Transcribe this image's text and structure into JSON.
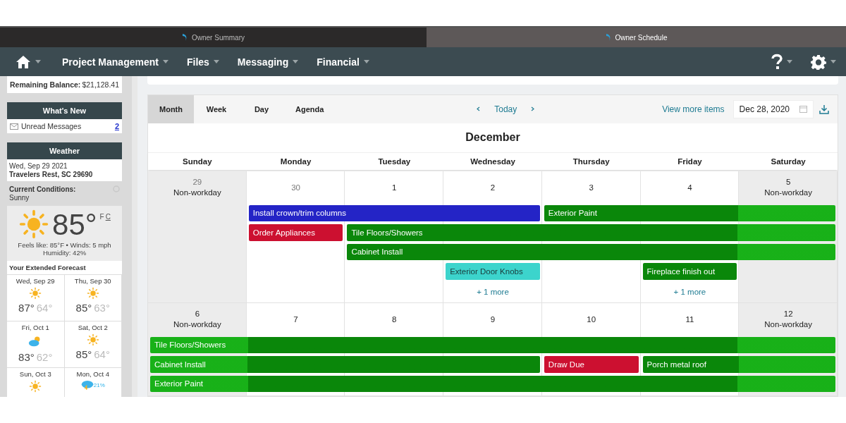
{
  "browser_tabs": [
    {
      "label": "Owner Summary",
      "selected": false
    },
    {
      "label": "Owner Schedule",
      "selected": true
    }
  ],
  "nav": {
    "menus": [
      "Project Management",
      "Files",
      "Messaging",
      "Financial"
    ]
  },
  "sidebar": {
    "balance": {
      "label": "Remaining Balance:",
      "value": "$21,128.41"
    },
    "whats_new": {
      "title": "What's New",
      "items": [
        {
          "label": "Unread Messages",
          "count": "2"
        }
      ]
    },
    "weather": {
      "title": "Weather",
      "date": "Wed, Sep 29 2021",
      "location": "Travelers Rest, SC 29690",
      "conditions_label": "Current Conditions:",
      "conditions": "Sunny",
      "temperature": "85°",
      "units": [
        {
          "label": "F",
          "selected": true
        },
        {
          "label": "C",
          "selected": false
        }
      ],
      "details": [
        "Feels like: 85°F • Winds: 5 mph",
        "Humidity: 42%"
      ],
      "forecast_title": "Your Extended Forecast",
      "forecast": [
        {
          "day": "Wed, Sep 29",
          "kind": "sunny",
          "high": "87°",
          "low": "64°"
        },
        {
          "day": "Thu, Sep 30",
          "kind": "sunny",
          "high": "85°",
          "low": "63°"
        },
        {
          "day": "Fri, Oct 1",
          "kind": "partly-cloudy",
          "high": "83°",
          "low": "62°"
        },
        {
          "day": "Sat, Oct 2",
          "kind": "sunny",
          "high": "85°",
          "low": "64°"
        },
        {
          "day": "Sun, Oct 3",
          "kind": "sunny"
        },
        {
          "day": "Mon, Oct 4",
          "kind": "rain",
          "precip": "21%"
        }
      ]
    }
  },
  "calendar": {
    "views": [
      {
        "label": "Month",
        "selected": true
      },
      {
        "label": "Week",
        "selected": false
      },
      {
        "label": "Day",
        "selected": false
      },
      {
        "label": "Agenda",
        "selected": false
      }
    ],
    "today": "Today",
    "view_more": "View more items",
    "date": "Dec 28, 2020",
    "month": "December",
    "weekdays": [
      "Sunday",
      "Monday",
      "Tuesday",
      "Wednesday",
      "Thursday",
      "Friday",
      "Saturday"
    ],
    "weeks": [
      {
        "days": [
          {
            "number": "29",
            "label": "Non-workday",
            "outside": true,
            "non_workday": true
          },
          {
            "number": "30",
            "outside": true,
            "non_workday": false
          },
          {
            "number": "1",
            "outside": false,
            "non_workday": false
          },
          {
            "number": "2",
            "outside": false,
            "non_workday": false,
            "more": "+ 1 more"
          },
          {
            "number": "3",
            "outside": false,
            "non_workday": false
          },
          {
            "number": "4",
            "outside": false,
            "non_workday": false,
            "more": "+ 1 more"
          },
          {
            "number": "5",
            "label": "Non-workday",
            "outside": false,
            "non_workday": true
          }
        ],
        "lanes": [
          [
            {
              "kind": "empty"
            },
            {
              "kind": "event",
              "title": "Install crown/trim columns",
              "color": "#2424c6"
            },
            {
              "kind": "continued"
            },
            {
              "kind": "continued"
            },
            {
              "kind": "event",
              "title": "Exterior Paint",
              "color": "#0a870a"
            },
            {
              "kind": "continued"
            },
            {
              "kind": "continued"
            }
          ],
          [
            {
              "kind": "empty"
            },
            {
              "kind": "event",
              "title": "Order Appliances",
              "color": "#cc1030"
            },
            {
              "kind": "event",
              "title": "Tile Floors/Showers",
              "color": "#0a870a"
            },
            {
              "kind": "continued"
            },
            {
              "kind": "continued"
            },
            {
              "kind": "continued"
            },
            {
              "kind": "continued"
            }
          ],
          [
            {
              "kind": "empty"
            },
            {
              "kind": "empty"
            },
            {
              "kind": "event",
              "title": "Cabinet Install",
              "color": "#0a870a"
            },
            {
              "kind": "continued"
            },
            {
              "kind": "continued"
            },
            {
              "kind": "continued"
            },
            {
              "kind": "continued"
            }
          ],
          [
            {
              "kind": "empty"
            },
            {
              "kind": "empty"
            },
            {
              "kind": "empty"
            },
            {
              "kind": "event",
              "title": "Exterior Door Knobs",
              "color": "#3cd4cc"
            },
            {
              "kind": "empty"
            },
            {
              "kind": "event",
              "title": "Fireplace finish out",
              "color": "#0a870a"
            },
            {
              "kind": "empty"
            }
          ]
        ]
      },
      {
        "days": [
          {
            "number": "6",
            "label": "Non-workday",
            "outside": false,
            "non_workday": true
          },
          {
            "number": "7",
            "outside": false,
            "non_workday": false
          },
          {
            "number": "8",
            "outside": false,
            "non_workday": false
          },
          {
            "number": "9",
            "outside": false,
            "non_workday": false
          },
          {
            "number": "10",
            "outside": false,
            "non_workday": false
          },
          {
            "number": "11",
            "outside": false,
            "non_workday": false
          },
          {
            "number": "12",
            "label": "Non-workday",
            "outside": false,
            "non_workday": true
          }
        ],
        "lanes": [
          [
            {
              "kind": "event",
              "title": "Tile Floors/Showers",
              "color": "#0a870a"
            },
            {
              "kind": "continued"
            },
            {
              "kind": "continued"
            },
            {
              "kind": "continued"
            },
            {
              "kind": "continued"
            },
            {
              "kind": "continued"
            },
            {
              "kind": "continued"
            }
          ],
          [
            {
              "kind": "event",
              "title": "Cabinet Install",
              "color": "#0a870a"
            },
            {
              "kind": "continued"
            },
            {
              "kind": "continued"
            },
            {
              "kind": "continued"
            },
            {
              "kind": "event",
              "title": "Draw Due",
              "color": "#cc1030"
            },
            {
              "kind": "event",
              "title": "Porch metal roof",
              "color": "#0a870a"
            },
            {
              "kind": "continued"
            }
          ],
          [
            {
              "kind": "event",
              "title": "Exterior Paint",
              "color": "#0a870a"
            },
            {
              "kind": "continued"
            },
            {
              "kind": "continued"
            },
            {
              "kind": "continued"
            },
            {
              "kind": "continued"
            },
            {
              "kind": "continued"
            },
            {
              "kind": "continued"
            }
          ]
        ]
      }
    ]
  }
}
